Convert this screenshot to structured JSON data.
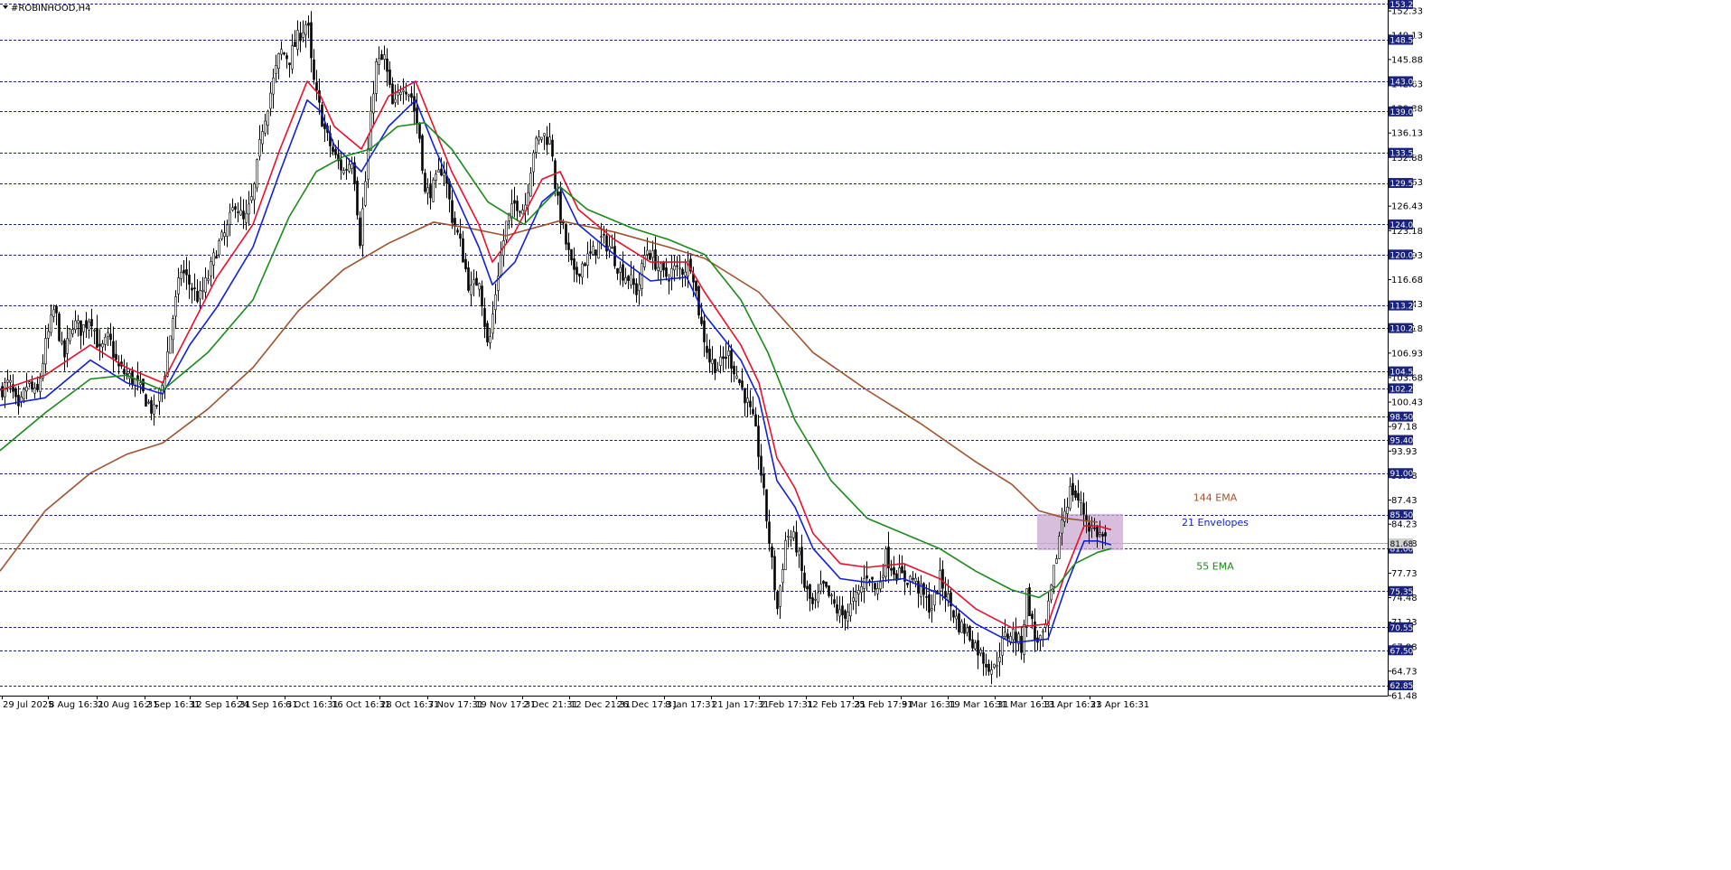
{
  "chart_data": {
    "type": "candlestick",
    "title": "#ROBINHOOD,H4",
    "colors": {
      "ema144": "#a0522d",
      "env_upper": "#e8102a",
      "env_lower": "#1020d8",
      "ema55": "#1a8a1a",
      "candle": "#000000",
      "level_line": "#1a237e",
      "price_tag_bg": "#1a237e",
      "price_tag_fg": "#ffffff",
      "zone_fill": "#c8a8d0"
    },
    "ylim": [
      61.48,
      153.3
    ],
    "price_ticks": [
      "152.33",
      "149.13",
      "145.88",
      "142.63",
      "139.38",
      "136.13",
      "132.88",
      "129.63",
      "126.43",
      "123.18",
      "119.93",
      "116.68",
      "113.43",
      "110.18",
      "106.93",
      "103.68",
      "100.43",
      "97.18",
      "93.93",
      "90.68",
      "87.43",
      "84.23",
      "81.68",
      "77.73",
      "74.48",
      "71.23",
      "67.98",
      "64.73",
      "61.48"
    ],
    "levels": [
      153.25,
      148.5,
      143.0,
      139.0,
      133.5,
      129.5,
      124.0,
      120.0,
      113.25,
      110.25,
      104.5,
      102.25,
      98.5,
      95.4,
      91.0,
      85.5,
      81.0,
      75.35,
      70.55,
      67.5,
      62.85
    ],
    "current_price": 81.68,
    "x_labels": [
      "29 Jul 2025",
      "8 Aug 16:31",
      "20 Aug 16:31",
      "2 Sep 16:31",
      "12 Sep 16:31",
      "24 Sep 16:31",
      "6 Oct 16:31",
      "16 Oct 16:31",
      "28 Oct 16:31",
      "7 Nov 17:31",
      "19 Nov 17:31",
      "2 Dec 21:31",
      "12 Dec 21:31",
      "26 Dec 17:31",
      "8 Jan 17:31",
      "21 Jan 17:31",
      "2 Feb 17:31",
      "12 Feb 17:31",
      "25 Feb 17:31",
      "9 Mar 16:31",
      "19 Mar 16:31",
      "31 Mar 16:31",
      "13 Apr 16:31",
      "23 Apr 16:31"
    ],
    "close_path": [
      [
        0,
        102
      ],
      [
        10,
        103
      ],
      [
        20,
        99
      ],
      [
        30,
        103
      ],
      [
        40,
        101
      ],
      [
        50,
        108
      ],
      [
        60,
        113
      ],
      [
        70,
        106
      ],
      [
        80,
        111
      ],
      [
        90,
        110
      ],
      [
        100,
        112
      ],
      [
        110,
        107
      ],
      [
        120,
        109
      ],
      [
        130,
        105
      ],
      [
        140,
        104
      ],
      [
        150,
        103
      ],
      [
        160,
        101
      ],
      [
        170,
        99
      ],
      [
        180,
        103
      ],
      [
        190,
        111
      ],
      [
        200,
        118
      ],
      [
        210,
        116
      ],
      [
        220,
        114
      ],
      [
        230,
        117
      ],
      [
        240,
        121
      ],
      [
        250,
        123
      ],
      [
        260,
        127
      ],
      [
        270,
        124
      ],
      [
        280,
        128
      ],
      [
        290,
        137
      ],
      [
        300,
        142
      ],
      [
        310,
        147
      ],
      [
        320,
        146
      ],
      [
        330,
        149
      ],
      [
        340,
        151
      ],
      [
        345,
        144
      ],
      [
        350,
        141
      ],
      [
        360,
        136
      ],
      [
        370,
        133
      ],
      [
        380,
        131
      ],
      [
        390,
        133
      ],
      [
        398,
        122
      ],
      [
        405,
        131
      ],
      [
        415,
        145
      ],
      [
        425,
        146
      ],
      [
        435,
        139
      ],
      [
        445,
        143
      ],
      [
        455,
        141
      ],
      [
        465,
        135
      ],
      [
        470,
        128
      ],
      [
        480,
        129
      ],
      [
        490,
        132
      ],
      [
        500,
        125
      ],
      [
        510,
        121
      ],
      [
        520,
        115
      ],
      [
        530,
        117
      ],
      [
        540,
        107
      ],
      [
        550,
        117
      ],
      [
        560,
        124
      ],
      [
        570,
        127
      ],
      [
        580,
        126
      ],
      [
        590,
        134
      ],
      [
        600,
        136
      ],
      [
        610,
        135
      ],
      [
        615,
        128
      ],
      [
        625,
        122
      ],
      [
        635,
        117
      ],
      [
        645,
        119
      ],
      [
        655,
        120
      ],
      [
        665,
        122
      ],
      [
        675,
        121
      ],
      [
        685,
        118
      ],
      [
        695,
        117
      ],
      [
        705,
        115
      ],
      [
        715,
        121
      ],
      [
        725,
        119
      ],
      [
        735,
        117
      ],
      [
        745,
        118
      ],
      [
        755,
        118
      ],
      [
        765,
        119
      ],
      [
        775,
        111
      ],
      [
        785,
        106
      ],
      [
        795,
        105
      ],
      [
        805,
        107
      ],
      [
        815,
        104
      ],
      [
        825,
        101
      ],
      [
        835,
        97
      ],
      [
        840,
        93
      ],
      [
        845,
        88
      ],
      [
        850,
        83
      ],
      [
        855,
        78
      ],
      [
        860,
        73
      ],
      [
        870,
        83
      ],
      [
        880,
        82
      ],
      [
        890,
        76
      ],
      [
        900,
        73
      ],
      [
        910,
        76
      ],
      [
        920,
        74
      ],
      [
        930,
        72
      ],
      [
        940,
        73
      ],
      [
        950,
        75
      ],
      [
        960,
        78
      ],
      [
        970,
        75
      ],
      [
        980,
        80
      ],
      [
        990,
        78
      ],
      [
        1000,
        77
      ],
      [
        1010,
        77
      ],
      [
        1020,
        75
      ],
      [
        1030,
        73
      ],
      [
        1040,
        77
      ],
      [
        1050,
        74
      ],
      [
        1060,
        71
      ],
      [
        1070,
        70
      ],
      [
        1080,
        68
      ],
      [
        1090,
        66
      ],
      [
        1100,
        65
      ],
      [
        1110,
        69
      ],
      [
        1120,
        70
      ],
      [
        1130,
        68
      ],
      [
        1136,
        75
      ],
      [
        1145,
        69
      ],
      [
        1155,
        69
      ],
      [
        1165,
        77
      ],
      [
        1175,
        85
      ],
      [
        1185,
        89
      ],
      [
        1195,
        87
      ],
      [
        1205,
        84
      ],
      [
        1215,
        83
      ],
      [
        1225,
        82
      ]
    ],
    "series": [
      {
        "values": [
          [
            0,
            78
          ],
          [
            50,
            86
          ],
          [
            100,
            91
          ],
          [
            140,
            93.5
          ],
          [
            180,
            95
          ],
          [
            230,
            99.5
          ],
          [
            280,
            105
          ],
          [
            330,
            112.5
          ],
          [
            380,
            118
          ],
          [
            430,
            121.5
          ],
          [
            480,
            124.3
          ],
          [
            520,
            123.5
          ],
          [
            560,
            122.5
          ],
          [
            620,
            124.5
          ],
          [
            680,
            123
          ],
          [
            740,
            121
          ],
          [
            780,
            119.5
          ],
          [
            840,
            115
          ],
          [
            900,
            107
          ],
          [
            960,
            102
          ],
          [
            1020,
            97.5
          ],
          [
            1080,
            92.5
          ],
          [
            1120,
            89.5
          ],
          [
            1150,
            86
          ],
          [
            1180,
            85
          ],
          [
            1215,
            84.5
          ]
        ]
      },
      {
        "values": [
          [
            0,
            102
          ],
          [
            50,
            104
          ],
          [
            100,
            108
          ],
          [
            140,
            105
          ],
          [
            180,
            103
          ],
          [
            210,
            110
          ],
          [
            240,
            117
          ],
          [
            280,
            124
          ],
          [
            310,
            134
          ],
          [
            340,
            143
          ],
          [
            355,
            141
          ],
          [
            370,
            137
          ],
          [
            400,
            134
          ],
          [
            430,
            141
          ],
          [
            460,
            143
          ],
          [
            480,
            137
          ],
          [
            500,
            131
          ],
          [
            530,
            124
          ],
          [
            545,
            119
          ],
          [
            570,
            123
          ],
          [
            600,
            130
          ],
          [
            620,
            131
          ],
          [
            640,
            126
          ],
          [
            680,
            122
          ],
          [
            720,
            119
          ],
          [
            760,
            119
          ],
          [
            780,
            115
          ],
          [
            820,
            108
          ],
          [
            840,
            103
          ],
          [
            860,
            93
          ],
          [
            880,
            89
          ],
          [
            900,
            83
          ],
          [
            930,
            79
          ],
          [
            960,
            78.5
          ],
          [
            1000,
            79
          ],
          [
            1040,
            77
          ],
          [
            1080,
            73
          ],
          [
            1120,
            70.5
          ],
          [
            1160,
            71
          ],
          [
            1180,
            78
          ],
          [
            1200,
            84
          ],
          [
            1215,
            84
          ],
          [
            1230,
            83.5
          ]
        ]
      },
      {
        "values": [
          [
            0,
            100
          ],
          [
            50,
            101
          ],
          [
            100,
            106
          ],
          [
            140,
            103
          ],
          [
            180,
            101.5
          ],
          [
            210,
            108
          ],
          [
            240,
            113
          ],
          [
            280,
            121
          ],
          [
            310,
            131
          ],
          [
            340,
            140.5
          ],
          [
            355,
            139
          ],
          [
            370,
            134.5
          ],
          [
            400,
            131
          ],
          [
            430,
            137
          ],
          [
            460,
            140.5
          ],
          [
            480,
            134.5
          ],
          [
            500,
            129
          ],
          [
            530,
            121
          ],
          [
            545,
            116
          ],
          [
            570,
            119
          ],
          [
            600,
            127
          ],
          [
            620,
            129
          ],
          [
            640,
            124
          ],
          [
            680,
            120
          ],
          [
            720,
            116.5
          ],
          [
            760,
            117
          ],
          [
            780,
            112
          ],
          [
            820,
            106
          ],
          [
            840,
            101
          ],
          [
            860,
            90
          ],
          [
            880,
            86.5
          ],
          [
            900,
            81
          ],
          [
            930,
            77
          ],
          [
            960,
            76.5
          ],
          [
            1000,
            77
          ],
          [
            1040,
            75
          ],
          [
            1080,
            71
          ],
          [
            1120,
            68.5
          ],
          [
            1160,
            69
          ],
          [
            1180,
            76
          ],
          [
            1200,
            82
          ],
          [
            1215,
            82
          ],
          [
            1230,
            81.5
          ]
        ]
      },
      {
        "values": [
          [
            0,
            94
          ],
          [
            50,
            99
          ],
          [
            100,
            103.5
          ],
          [
            140,
            104
          ],
          [
            180,
            102
          ],
          [
            230,
            107
          ],
          [
            280,
            114
          ],
          [
            320,
            125
          ],
          [
            350,
            131
          ],
          [
            380,
            133
          ],
          [
            410,
            134
          ],
          [
            440,
            137
          ],
          [
            470,
            137.5
          ],
          [
            500,
            134
          ],
          [
            540,
            127
          ],
          [
            580,
            124
          ],
          [
            620,
            129
          ],
          [
            650,
            126
          ],
          [
            700,
            123.5
          ],
          [
            740,
            122
          ],
          [
            780,
            120
          ],
          [
            820,
            114
          ],
          [
            850,
            107
          ],
          [
            880,
            98
          ],
          [
            920,
            90
          ],
          [
            960,
            85
          ],
          [
            1000,
            83
          ],
          [
            1040,
            81
          ],
          [
            1080,
            78
          ],
          [
            1120,
            75.5
          ],
          [
            1150,
            74.5
          ],
          [
            1170,
            76
          ],
          [
            1190,
            79
          ],
          [
            1215,
            80.5
          ],
          [
            1230,
            81
          ]
        ]
      }
    ],
    "annotations": [
      {
        "text": "144 EMA",
        "color": "#a0522d"
      },
      {
        "text": "21 Envelopes",
        "color": "#1020d8"
      },
      {
        "text": "55 EMA",
        "color": "#1a8a1a"
      }
    ],
    "zone": {
      "x0": 1148,
      "x1": 1243,
      "y0": 80.8,
      "y1": 85.6
    }
  }
}
